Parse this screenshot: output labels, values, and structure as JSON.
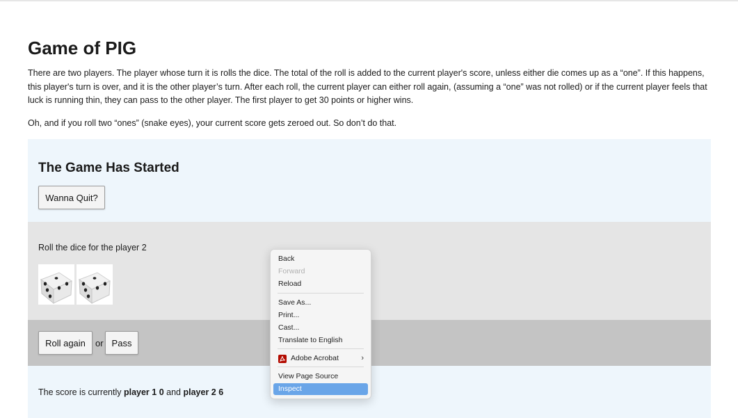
{
  "page": {
    "title": "Game of PIG",
    "intro": "There are two players. The player whose turn it is rolls the dice. The total of the roll is added to the current player's score, unless either die comes up as a “one”. If this happens, this player's turn is over, and it is the other player’s turn. After each roll, the current player can either roll again, (assuming a “one” was not rolled) or if the current player feels that luck is running thin, they can pass to the other player. The first player to get 30 points or higher wins.",
    "warning": "Oh, and if you roll two “ones” (snake eyes), your current score gets zeroed out. So don’t do that."
  },
  "game": {
    "heading": "The Game Has Started",
    "quit_label": "Wanna Quit?",
    "roll_prompt": "Roll the dice for the player 2",
    "dice": [
      3,
      3
    ],
    "roll_again_label": "Roll again",
    "or_text": "or",
    "pass_label": "Pass",
    "score": {
      "prefix": "The score is currently",
      "p1_label": "player 1",
      "p1_score": "0",
      "and_text": "and",
      "p2_label": "player 2",
      "p2_score": "6"
    }
  },
  "context_menu": {
    "items": [
      {
        "label": "Back",
        "enabled": true
      },
      {
        "label": "Forward",
        "enabled": false
      },
      {
        "label": "Reload",
        "enabled": true
      },
      {
        "label": "Save As...",
        "enabled": true
      },
      {
        "label": "Print...",
        "enabled": true
      },
      {
        "label": "Cast...",
        "enabled": true
      },
      {
        "label": "Translate to English",
        "enabled": true
      },
      {
        "label": "Adobe Acrobat",
        "enabled": true,
        "icon": "adobe-acrobat-icon",
        "submenu": true
      },
      {
        "label": "View Page Source",
        "enabled": true
      },
      {
        "label": "Inspect",
        "enabled": true,
        "selected": true
      }
    ]
  },
  "colors": {
    "light_panel": "#eef6fc",
    "dice_panel": "#e5e5e5",
    "actions_panel": "#c4c4c4",
    "menu_highlight": "#6aa5e8",
    "acrobat_red": "#b30b00"
  }
}
